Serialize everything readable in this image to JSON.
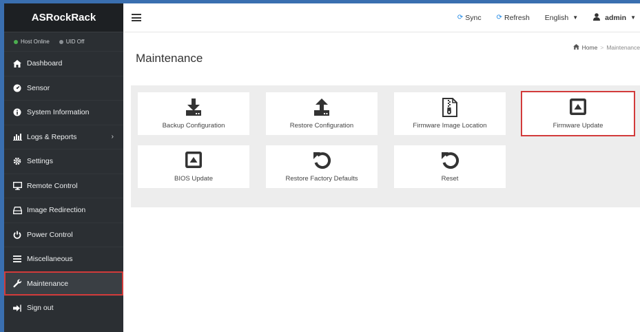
{
  "brand": "ASRockRack",
  "status": {
    "host": "Host Online",
    "uid": "UID Off"
  },
  "sidebar": {
    "items": [
      {
        "label": "Dashboard",
        "icon": "dashboard-icon"
      },
      {
        "label": "Sensor",
        "icon": "sensor-icon"
      },
      {
        "label": "System Information",
        "icon": "info-icon"
      },
      {
        "label": "Logs & Reports",
        "icon": "chart-icon"
      },
      {
        "label": "Settings",
        "icon": "gear-icon"
      },
      {
        "label": "Remote Control",
        "icon": "monitor-icon"
      },
      {
        "label": "Image Redirection",
        "icon": "drive-icon"
      },
      {
        "label": "Power Control",
        "icon": "power-icon"
      },
      {
        "label": "Miscellaneous",
        "icon": "list-icon"
      },
      {
        "label": "Maintenance",
        "icon": "wrench-icon"
      },
      {
        "label": "Sign out",
        "icon": "signout-icon"
      }
    ]
  },
  "topbar": {
    "sync": "Sync",
    "refresh": "Refresh",
    "language": "English",
    "user": "admin"
  },
  "page": {
    "title": "Maintenance",
    "breadcrumb_home": "Home",
    "breadcrumb_current": "Maintenance"
  },
  "cards": [
    {
      "label": "Backup Configuration",
      "icon": "download-icon"
    },
    {
      "label": "Restore Configuration",
      "icon": "upload-icon"
    },
    {
      "label": "Firmware Image Location",
      "icon": "zip-file-icon"
    },
    {
      "label": "Firmware Update",
      "icon": "firmware-update-icon"
    },
    {
      "label": "BIOS Update",
      "icon": "bios-update-icon"
    },
    {
      "label": "Restore Factory Defaults",
      "icon": "undo-icon"
    },
    {
      "label": "Reset",
      "icon": "reset-icon"
    }
  ],
  "colors": {
    "sidebar_bg": "#2b2f33",
    "brand_bg": "#1d2023",
    "frame": "#3a6fb0",
    "highlight": "#d23a3a",
    "host_online": "#4caf50",
    "accent": "#1e88e5"
  }
}
